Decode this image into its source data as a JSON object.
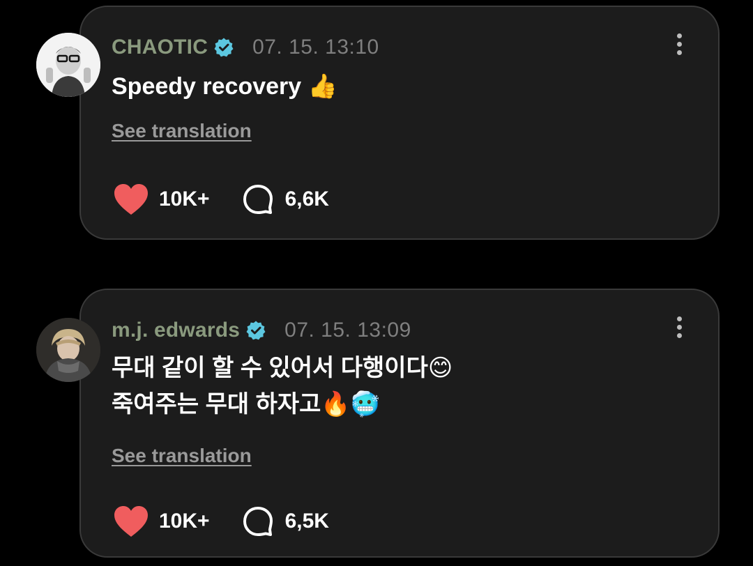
{
  "posts": [
    {
      "username": "CHAOTIC",
      "timestamp": "07. 15. 13:10",
      "text_lines": [
        "Speedy recovery 👍"
      ],
      "translate_label": "See translation",
      "likes": "10K+",
      "comments": "6,6K"
    },
    {
      "username": "m.j. edwards",
      "timestamp": "07. 15. 13:09",
      "text_lines": [
        "무대 같이 할 수 있어서 다행이다😊",
        "죽여주는 무대 하자고🔥🥶"
      ],
      "translate_label": "See translation",
      "likes": "10K+",
      "comments": "6,5K"
    }
  ],
  "colors": {
    "background": "#000000",
    "card": "#1c1c1c",
    "card_border": "#3a3a3a",
    "username": "#8a9a7e",
    "verified": "#5cc7e0",
    "heart": "#f05d5e",
    "timestamp": "#7f7f7f"
  },
  "icons": {
    "verified": "verified-badge-icon",
    "more": "kebab-menu-icon",
    "like": "heart-icon",
    "comment": "comment-bubble-icon"
  }
}
